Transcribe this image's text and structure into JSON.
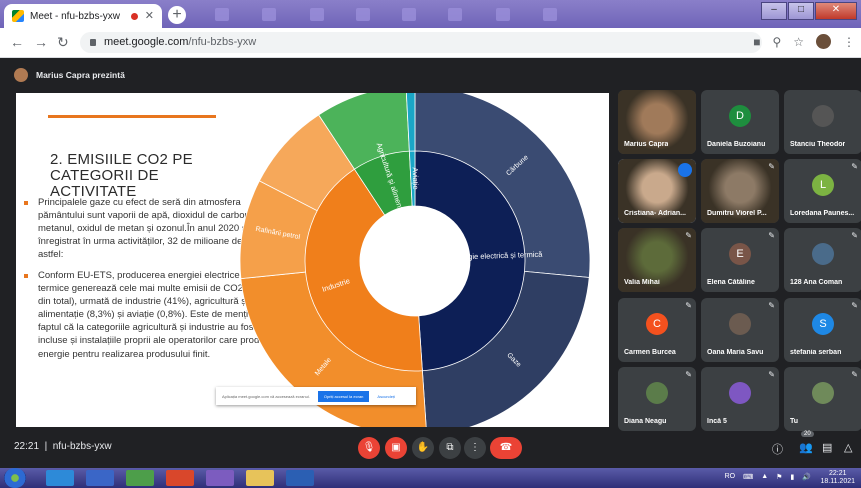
{
  "browser": {
    "tab_title": "Meet - nfu-bzbs-yxw",
    "url_host": "meet.google.com",
    "url_path": "/nfu-bzbs-yxw"
  },
  "meet": {
    "presenter_label": "Marius Capra prezintă",
    "meeting_time": "22:21",
    "meeting_code": "nfu-bzbs-yxw",
    "participants_badge": "20"
  },
  "slide": {
    "title": "2.   EMISIILE CO2 PE CATEGORII DE ACTIVITATE",
    "bullet1": "Principalele gaze cu efect de seră din atmosfera pământului sunt vaporii de apă, dioxidul de carbon, metanul, oxidul de metan și ozonul.În anul 2020 s-au înregistrat în urma activităților, 32 de milioane de tone astfel:",
    "bullet2": "Conform  EU-ETS, producerea energiei electrice și termice generează cele mai multe emisii de CO2 (48% din total), urmată de industrie (41%), agricultură și alimentație (8,3%) și aviație (0,8%). Este de menționat faptul că la categoriile agricultură și industrie au fost incluse și instalațiile proprii ale operatorilor care produc energie pentru realizarea produsului finit.",
    "share_banner": {
      "message": "Aplicația meet.google.com vă accesează ecranul.",
      "stop_button": "Opriți accesul la ecran",
      "hide_button": "Ascundeți"
    }
  },
  "chart_data": {
    "type": "pie",
    "inner": [
      {
        "label": "Energie electrică și termică",
        "value": 48,
        "color": "#0d1f56"
      },
      {
        "label": "Industrie",
        "value": 41,
        "color": "#f07f1b"
      },
      {
        "label": "Agricultură și alimentație",
        "value": 8.3,
        "color": "#2f9e3e"
      },
      {
        "label": "Aviație",
        "value": 0.8,
        "color": "#1aa6c6"
      }
    ],
    "outer": [
      {
        "label": "Cărbune",
        "value": 26,
        "color": "#3a4b72"
      },
      {
        "label": "Gaze",
        "value": 22,
        "color": "#2f3e63"
      },
      {
        "label": "Metale",
        "value": 24,
        "color": "#f28e2b"
      },
      {
        "label": "Rafinării petrol",
        "value": 9,
        "color": "#f5a04a"
      },
      {
        "label": "",
        "value": 8,
        "color": "#f6a85a"
      },
      {
        "label": "",
        "value": 8.3,
        "color": "#4cb35a"
      },
      {
        "label": "",
        "value": 0.8,
        "color": "#1aa6c6"
      }
    ]
  },
  "participants": [
    {
      "name": "Marius Capra",
      "initial": "",
      "color": "#a07a5a",
      "video": true,
      "muted": false
    },
    {
      "name": "Daniela Buzoianu",
      "initial": "D",
      "color": "#1e8e3e",
      "video": false,
      "muted": false
    },
    {
      "name": "Stanciu Theodor",
      "initial": "",
      "color": "#555",
      "video": false,
      "muted": false
    },
    {
      "name": "Cristiana- Adrian...",
      "initial": "",
      "color": "#c9a98c",
      "video": true,
      "muted": false
    },
    {
      "name": "Dumitru Viorel P...",
      "initial": "",
      "color": "#8d7a66",
      "video": true,
      "muted": true
    },
    {
      "name": "Loredana Paunes...",
      "initial": "L",
      "color": "#7cb342",
      "video": false,
      "muted": true
    },
    {
      "name": "Valia Mihai",
      "initial": "",
      "color": "#5d6b3a",
      "video": true,
      "muted": true
    },
    {
      "name": "Elena Cătăline",
      "initial": "E",
      "color": "#795548",
      "video": false,
      "muted": true
    },
    {
      "name": "128 Ana Coman",
      "initial": "",
      "color": "#4a6b8a",
      "video": false,
      "muted": true
    },
    {
      "name": "Carmen Burcea",
      "initial": "C",
      "color": "#f4511e",
      "video": false,
      "muted": true
    },
    {
      "name": "Oana Maria Savu",
      "initial": "",
      "color": "#6b5b50",
      "video": false,
      "muted": true
    },
    {
      "name": "stefania serban",
      "initial": "S",
      "color": "#1e88e5",
      "video": false,
      "muted": true
    },
    {
      "name": "Diana Neagu",
      "initial": "",
      "color": "#5b7c4a",
      "video": false,
      "muted": true
    },
    {
      "name": "Încă 5",
      "initial": "",
      "color": "#7e57c2",
      "video": false,
      "muted": true
    },
    {
      "name": "Tu",
      "initial": "",
      "color": "#6f8a5a",
      "video": false,
      "muted": true
    }
  ],
  "taskbar": {
    "lang": "RO",
    "time": "22:21",
    "date": "18.11.2021"
  }
}
